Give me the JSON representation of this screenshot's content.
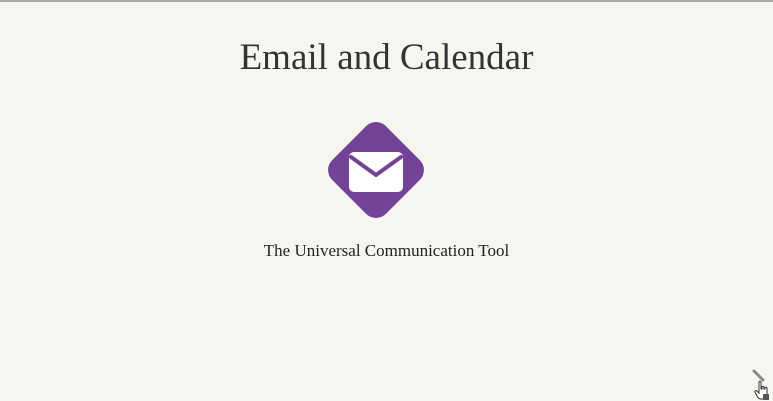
{
  "slide": {
    "title": "Email and Calendar",
    "subtitle": "The Universal Communication Tool",
    "logo_icon": "envelope-icon",
    "accent_color": "#744296"
  },
  "navigation": {
    "next_icon": "chevron-right-icon"
  }
}
